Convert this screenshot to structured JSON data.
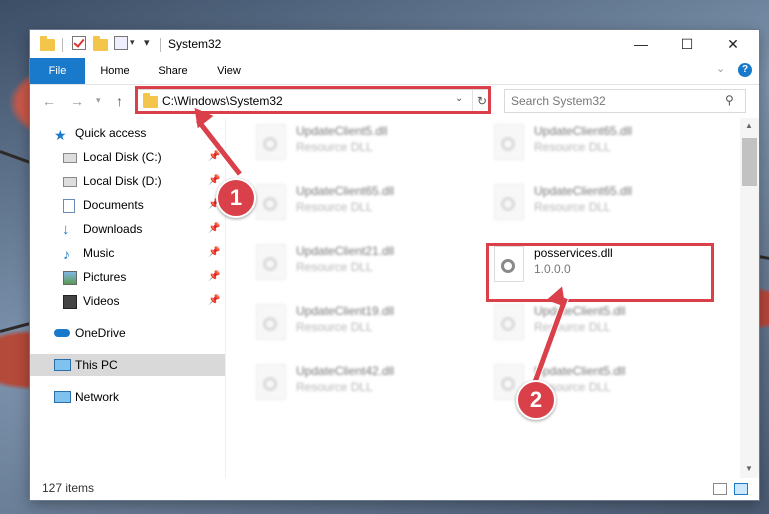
{
  "window": {
    "title": "System32",
    "controls": {
      "minimize": "—",
      "maximize": "☐",
      "close": "✕"
    }
  },
  "ribbon": {
    "tabs": [
      {
        "label": "File"
      },
      {
        "label": "Home"
      },
      {
        "label": "Share"
      },
      {
        "label": "View"
      }
    ]
  },
  "address": {
    "path": "C:\\Windows\\System32",
    "search_placeholder": "Search System32"
  },
  "sidebar": {
    "quick_access": "Quick access",
    "items": [
      {
        "label": "Local Disk (C:)"
      },
      {
        "label": "Local Disk (D:)"
      },
      {
        "label": "Documents"
      },
      {
        "label": "Downloads"
      },
      {
        "label": "Music"
      },
      {
        "label": "Pictures"
      },
      {
        "label": "Videos"
      }
    ],
    "onedrive": "OneDrive",
    "this_pc": "This PC",
    "network": "Network"
  },
  "files": [
    {
      "name": "UpdateClient5.dll",
      "desc": "Resource DLL"
    },
    {
      "name": "UpdateClient65.dll",
      "desc": "Resource DLL"
    },
    {
      "name": "UpdateClient65.dll",
      "desc": "Resource DLL"
    },
    {
      "name": "UpdateClient65.dll",
      "desc": "Resource DLL"
    },
    {
      "name": "UpdateClient21.dll",
      "desc": "Resource DLL"
    },
    {
      "name": "posservices.dll",
      "desc": "1.0.0.0"
    },
    {
      "name": "UpdateClient19.dll",
      "desc": "Resource DLL"
    },
    {
      "name": "UpdateClient5.dll",
      "desc": "Resource DLL"
    },
    {
      "name": "UpdateClient42.dll",
      "desc": "Resource DLL"
    },
    {
      "name": "UpdateClient5.dll",
      "desc": "Resource DLL"
    }
  ],
  "status": {
    "item_count": "127 items"
  },
  "annotations": {
    "step1": "1",
    "step2": "2",
    "color": "#d94049"
  }
}
